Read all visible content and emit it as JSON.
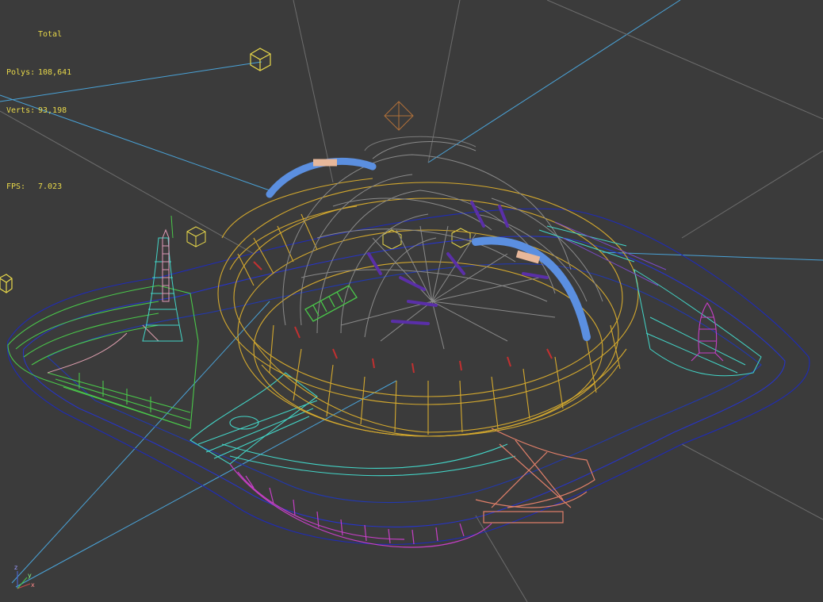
{
  "viewport": {
    "stats": {
      "total_label": "Total",
      "polys_label": "Polys:",
      "polys_value": "108,641",
      "verts_label": "Verts:",
      "verts_value": "93,198",
      "fps_label": "FPS:",
      "fps_value": "7.023"
    },
    "axis_gizmo": {
      "x": "x",
      "y": "y",
      "z": "z"
    },
    "colors": {
      "background": "#3b3b3b",
      "stats_text": "#e8d84a",
      "camera_line": "#4aa3d8",
      "helper_box": "#e8d84a",
      "wire_blue": "#1f2bb8",
      "wire_gold": "#d4a92e",
      "wire_gray": "#8a8a8a",
      "wire_cyan": "#43d6c8",
      "wire_green": "#4ac84a",
      "wire_magenta": "#c63fc6",
      "wire_salmon": "#e2806a",
      "arch_blue": "#5b8fe0"
    }
  }
}
